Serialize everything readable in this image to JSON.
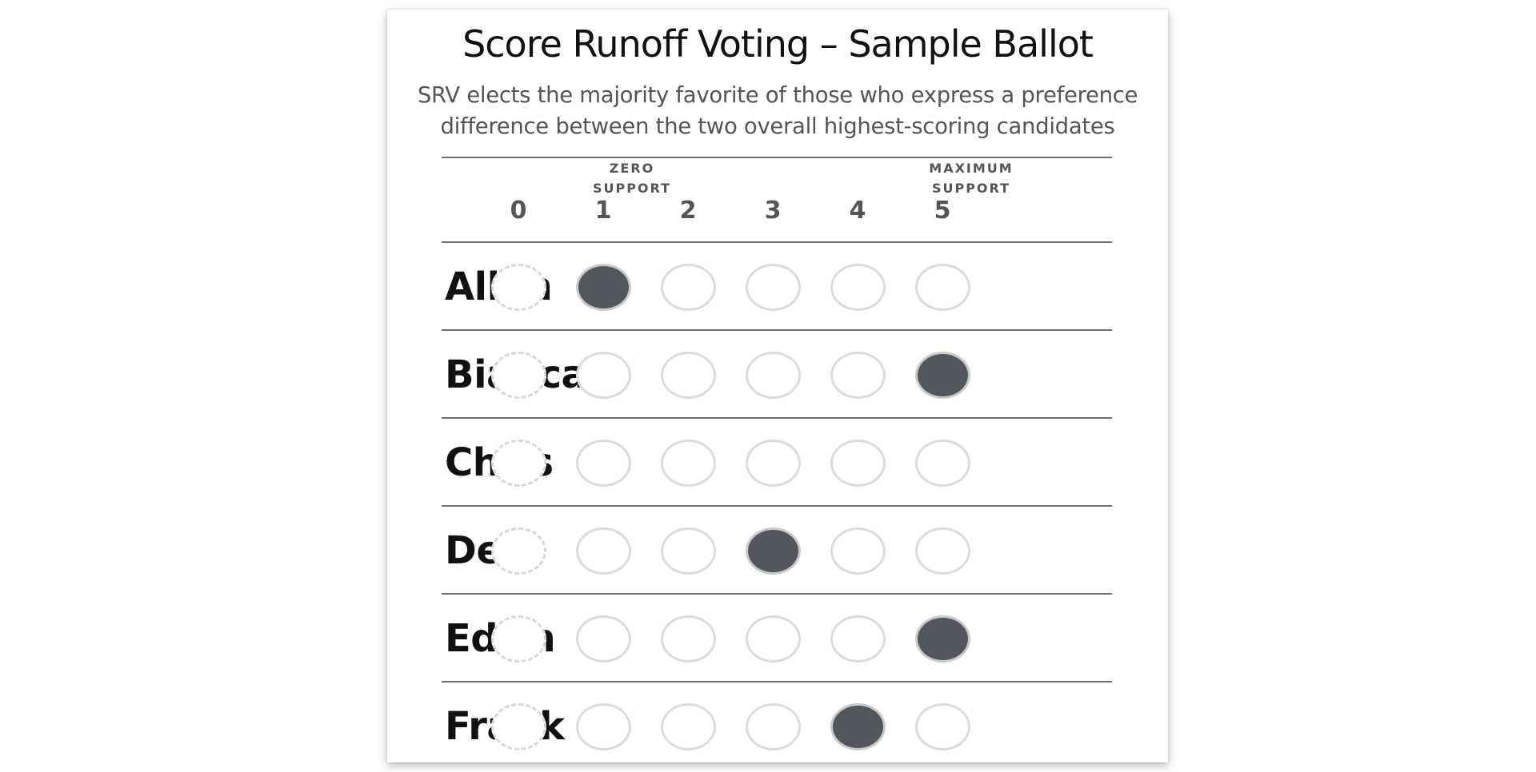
{
  "title": "Score Runoff Voting – Sample Ballot",
  "subtitle": {
    "line1": "SRV elects the majority favorite of those who express a preference",
    "line2": "difference between the two overall highest-scoring candidates"
  },
  "header": {
    "zero_label_line1": "Zero",
    "zero_label_line2": "support",
    "max_label_line1": "Maximum",
    "max_label_line2": "support",
    "scores": [
      "0",
      "1",
      "2",
      "3",
      "4",
      "5"
    ]
  },
  "candidates": [
    {
      "name": "Allen",
      "score": 1
    },
    {
      "name": "Bianca",
      "score": 5
    },
    {
      "name": "Chris",
      "score": null
    },
    {
      "name": "Desi",
      "score": 3
    },
    {
      "name": "Edith",
      "score": 5
    },
    {
      "name": "Frank",
      "score": 4
    }
  ],
  "colors": {
    "filled_bubble": "#53575d",
    "empty_bubble_border": "#dcdcdc",
    "rule": "#707070",
    "text_dark": "#111111",
    "text_grey": "#555555"
  }
}
